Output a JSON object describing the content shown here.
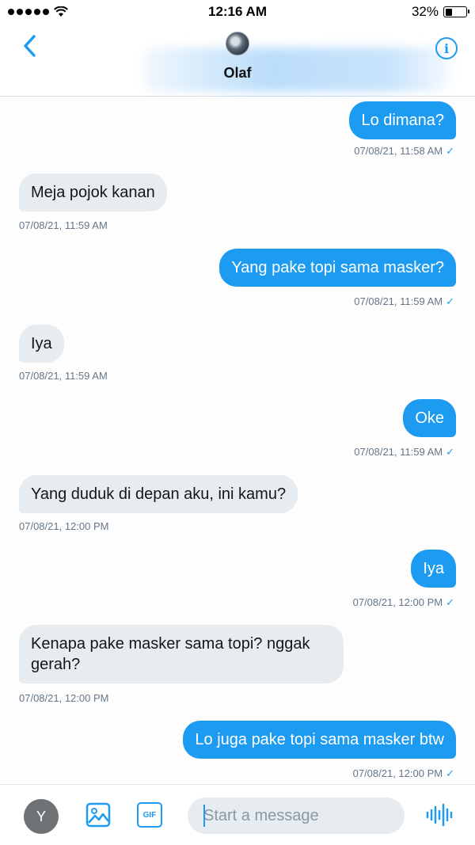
{
  "status_bar": {
    "time": "12:16 AM",
    "battery": "32%",
    "battery_level": 0.32
  },
  "header": {
    "back_icon": "chevron-left-icon",
    "contact_name": "Olaf",
    "info_icon": "info-icon",
    "accent_color": "#1d9bf0"
  },
  "messages": [
    {
      "direction": "outgoing",
      "text": "Lo dimana?",
      "timestamp": "07/08/21, 11:58 AM"
    },
    {
      "direction": "incoming",
      "text": "Meja pojok kanan",
      "timestamp": "07/08/21, 11:59 AM"
    },
    {
      "direction": "outgoing",
      "text": "Yang pake topi sama masker?",
      "timestamp": "07/08/21, 11:59 AM"
    },
    {
      "direction": "incoming",
      "text": "Iya",
      "timestamp": "07/08/21, 11:59 AM"
    },
    {
      "direction": "outgoing",
      "text": "Oke",
      "timestamp": "07/08/21, 11:59 AM"
    },
    {
      "direction": "incoming",
      "text": "Yang duduk di depan aku, ini kamu?",
      "timestamp": "07/08/21, 12:00 PM"
    },
    {
      "direction": "outgoing",
      "text": "Iya",
      "timestamp": "07/08/21, 12:00 PM"
    },
    {
      "direction": "incoming",
      "text": "Kenapa pake masker sama topi? nggak gerah?",
      "timestamp": "07/08/21, 12:00 PM"
    },
    {
      "direction": "outgoing",
      "text": "Lo juga pake topi sama masker btw",
      "timestamp": "07/08/21, 12:00 PM"
    }
  ],
  "read_mark": "✓",
  "composer": {
    "user_initial": "Y",
    "image_icon": "image-icon",
    "gif_label": "GIF",
    "placeholder": "Start a message",
    "voice_icon": "voice-waveform-icon"
  },
  "colors": {
    "outgoing_bubble": "#1d9bf0",
    "incoming_bubble": "#e6ecf0",
    "timestamp_text": "#657786"
  }
}
